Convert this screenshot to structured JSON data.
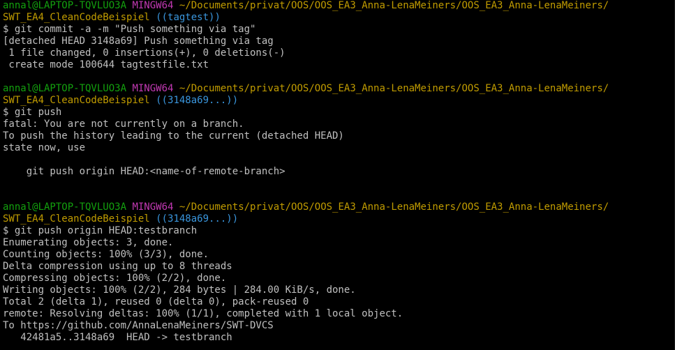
{
  "colors": {
    "background": "#000000",
    "default": "#c0c0c0",
    "user_host": "#13a10e",
    "mingw": "#c239b3",
    "path": "#c19c00",
    "branch": "#3a96dd"
  },
  "lines": [
    [
      {
        "text": "annal@LAPTOP-TQVLUO3A",
        "color": "user_host"
      },
      {
        "text": " ",
        "color": "default"
      },
      {
        "text": "MINGW64",
        "color": "mingw"
      },
      {
        "text": " ",
        "color": "default"
      },
      {
        "text": "~/Documents/privat/OOS/OOS_EA3_Anna-LenaMeiners/OOS_EA3_Anna-LenaMeiners/",
        "color": "path"
      }
    ],
    [
      {
        "text": "SWT_EA4_CleanCodeBeispiel",
        "color": "path"
      },
      {
        "text": " ",
        "color": "default"
      },
      {
        "text": "((tagtest))",
        "color": "branch"
      }
    ],
    [
      {
        "text": "$ git commit -a -m \"Push something via tag\"",
        "color": "default"
      }
    ],
    [
      {
        "text": "[detached HEAD 3148a69] Push something via tag",
        "color": "default"
      }
    ],
    [
      {
        "text": " 1 file changed, 0 insertions(+), 0 deletions(-)",
        "color": "default"
      }
    ],
    [
      {
        "text": " create mode 100644 tagtestfile.txt",
        "color": "default"
      }
    ],
    [
      {
        "text": "",
        "color": "default"
      }
    ],
    [
      {
        "text": "annal@LAPTOP-TQVLUO3A",
        "color": "user_host"
      },
      {
        "text": " ",
        "color": "default"
      },
      {
        "text": "MINGW64",
        "color": "mingw"
      },
      {
        "text": " ",
        "color": "default"
      },
      {
        "text": "~/Documents/privat/OOS/OOS_EA3_Anna-LenaMeiners/OOS_EA3_Anna-LenaMeiners/",
        "color": "path"
      }
    ],
    [
      {
        "text": "SWT_EA4_CleanCodeBeispiel",
        "color": "path"
      },
      {
        "text": " ",
        "color": "default"
      },
      {
        "text": "((3148a69...))",
        "color": "branch"
      }
    ],
    [
      {
        "text": "$ git push",
        "color": "default"
      }
    ],
    [
      {
        "text": "fatal: You are not currently on a branch.",
        "color": "default"
      }
    ],
    [
      {
        "text": "To push the history leading to the current (detached HEAD)",
        "color": "default"
      }
    ],
    [
      {
        "text": "state now, use",
        "color": "default"
      }
    ],
    [
      {
        "text": "",
        "color": "default"
      }
    ],
    [
      {
        "text": "    git push origin HEAD:<name-of-remote-branch>",
        "color": "default"
      }
    ],
    [
      {
        "text": "",
        "color": "default"
      }
    ],
    [
      {
        "text": "",
        "color": "default"
      }
    ],
    [
      {
        "text": "annal@LAPTOP-TQVLUO3A",
        "color": "user_host"
      },
      {
        "text": " ",
        "color": "default"
      },
      {
        "text": "MINGW64",
        "color": "mingw"
      },
      {
        "text": " ",
        "color": "default"
      },
      {
        "text": "~/Documents/privat/OOS/OOS_EA3_Anna-LenaMeiners/OOS_EA3_Anna-LenaMeiners/",
        "color": "path"
      }
    ],
    [
      {
        "text": "SWT_EA4_CleanCodeBeispiel",
        "color": "path"
      },
      {
        "text": " ",
        "color": "default"
      },
      {
        "text": "((3148a69...))",
        "color": "branch"
      }
    ],
    [
      {
        "text": "$ git push origin HEAD:testbranch",
        "color": "default"
      }
    ],
    [
      {
        "text": "Enumerating objects: 3, done.",
        "color": "default"
      }
    ],
    [
      {
        "text": "Counting objects: 100% (3/3), done.",
        "color": "default"
      }
    ],
    [
      {
        "text": "Delta compression using up to 8 threads",
        "color": "default"
      }
    ],
    [
      {
        "text": "Compressing objects: 100% (2/2), done.",
        "color": "default"
      }
    ],
    [
      {
        "text": "Writing objects: 100% (2/2), 284 bytes | 284.00 KiB/s, done.",
        "color": "default"
      }
    ],
    [
      {
        "text": "Total 2 (delta 1), reused 0 (delta 0), pack-reused 0",
        "color": "default"
      }
    ],
    [
      {
        "text": "remote: Resolving deltas: 100% (1/1), completed with 1 local object.",
        "color": "default"
      }
    ],
    [
      {
        "text": "To https://github.com/AnnaLenaMeiners/SWT-DVCS",
        "color": "default"
      }
    ],
    [
      {
        "text": "   42481a5..3148a69  HEAD -> testbranch",
        "color": "default"
      }
    ]
  ]
}
